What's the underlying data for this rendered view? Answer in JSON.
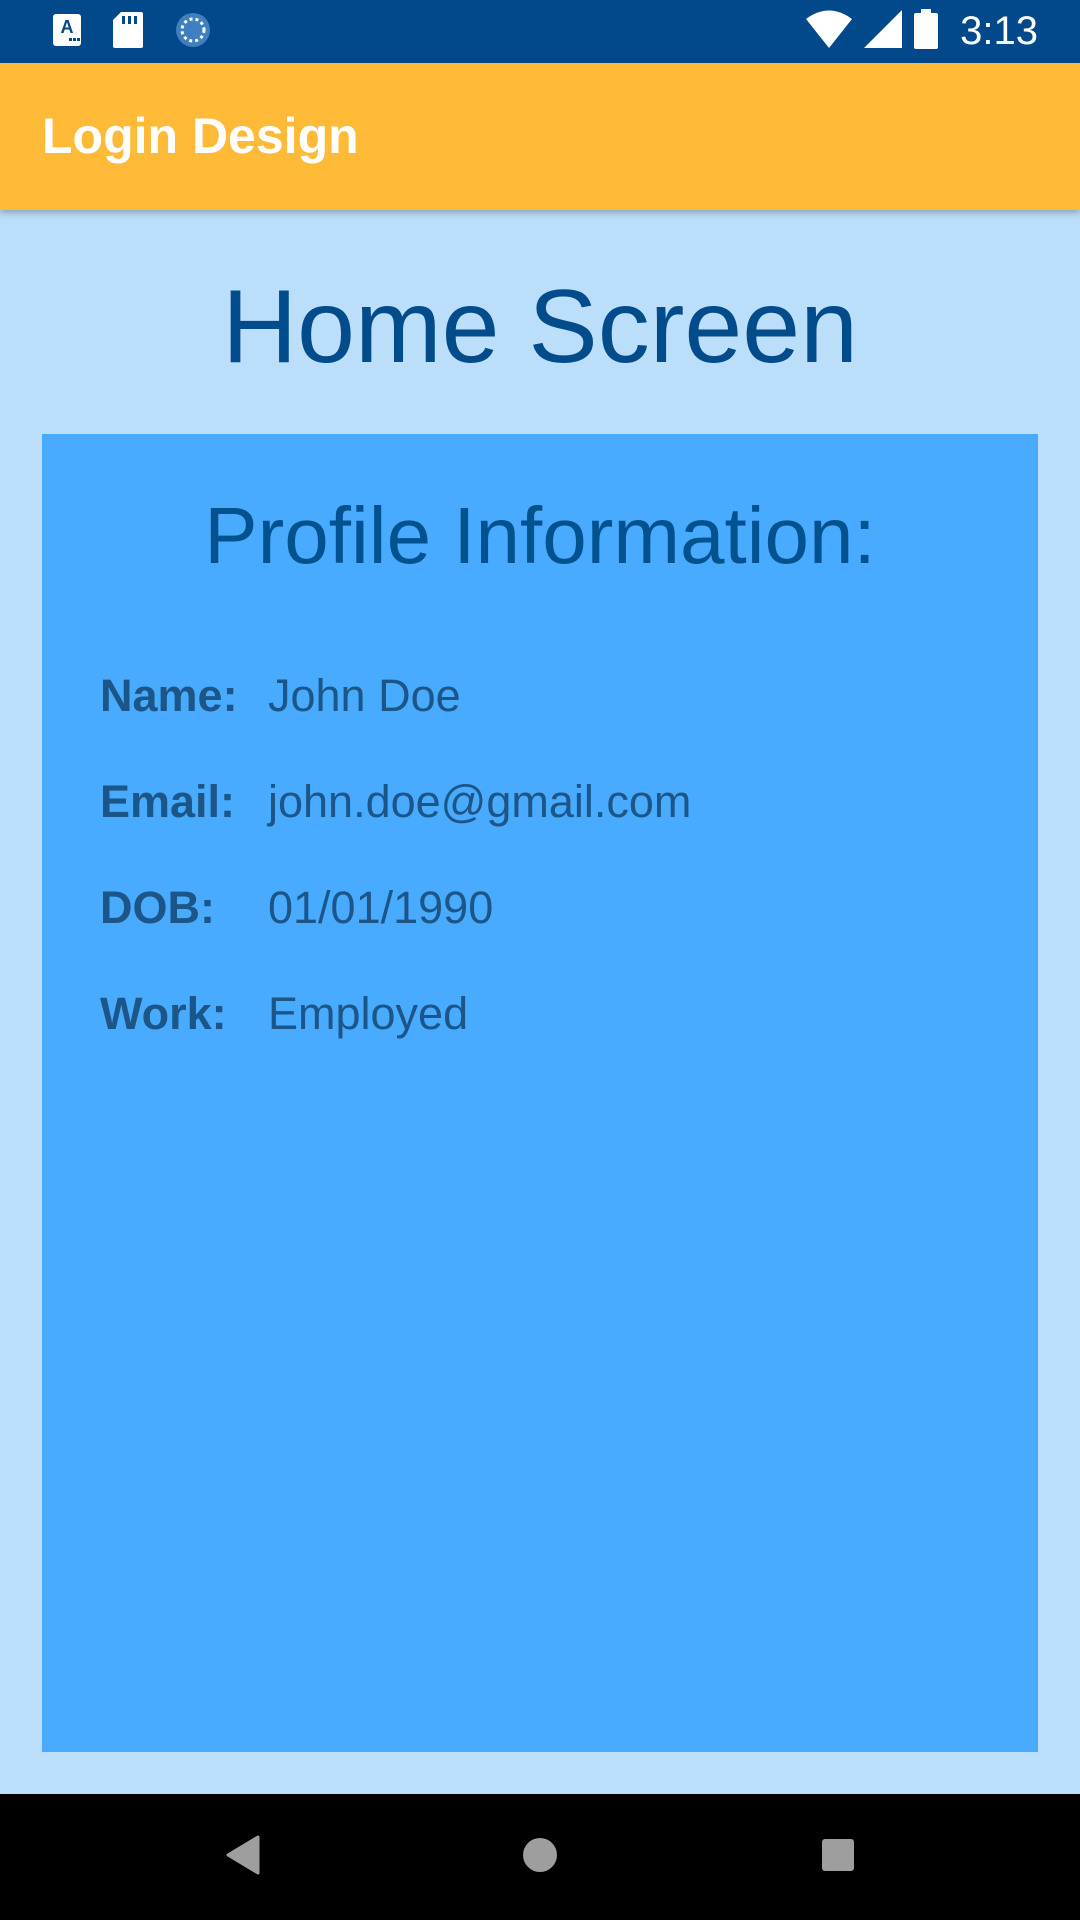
{
  "status_bar": {
    "time": "3:13",
    "icons": [
      "accessibility-font-icon",
      "sd-card-icon",
      "sync-progress-icon",
      "wifi-icon",
      "cell-signal-icon",
      "battery-icon"
    ]
  },
  "app_bar": {
    "title": "Login Design",
    "color": "#FFBB38"
  },
  "main": {
    "title": "Home Screen",
    "title_color": "#034C8C",
    "background": "#BBDEFB"
  },
  "profile": {
    "heading": "Profile Information:",
    "card_color": "#48ABFF",
    "fields": [
      {
        "label": "Name:",
        "value": "John Doe"
      },
      {
        "label": "Email:",
        "value": "john.doe@gmail.com"
      },
      {
        "label": "DOB:",
        "value": "01/01/1990"
      },
      {
        "label": "Work:",
        "value": "Employed"
      }
    ]
  },
  "nav_bar": {
    "buttons": [
      "back-icon",
      "home-icon",
      "recents-icon"
    ]
  }
}
